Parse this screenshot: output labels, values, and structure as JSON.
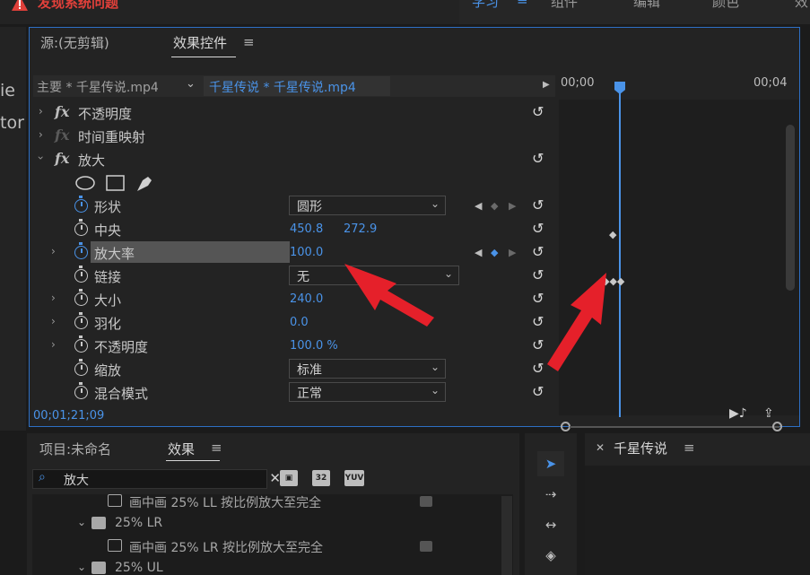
{
  "topbar": {
    "warning": "发现系统问题",
    "workspaces": [
      "学习",
      "组件",
      "编辑",
      "颜色",
      "效"
    ],
    "menu_glyph": "≡"
  },
  "leftcut": [
    "ie",
    "tor"
  ],
  "effect_controls": {
    "tabs": [
      "源:(无剪辑)",
      "效果控件"
    ],
    "menu_glyph": "≡",
    "master_clip": "主要 * 千星传说.mp4",
    "sequence_clip": "千星传说 * 千星传说.mp4",
    "timecode": "00;01;21;09",
    "effects": [
      {
        "name": "不透明度",
        "expanded": false
      },
      {
        "name": "时间重映射",
        "expanded": false
      },
      {
        "name": "放大",
        "expanded": true
      }
    ],
    "properties": [
      {
        "name": "形状",
        "type": "dropdown",
        "value": "圆形"
      },
      {
        "name": "中央",
        "type": "pair",
        "values": [
          "450.8",
          "272.9"
        ]
      },
      {
        "name": "放大率",
        "type": "value",
        "value": "100.0"
      },
      {
        "name": "链接",
        "type": "dropdown",
        "value": "无"
      },
      {
        "name": "大小",
        "type": "value",
        "value": "240.0"
      },
      {
        "name": "羽化",
        "type": "value",
        "value": "0.0"
      },
      {
        "name": "不透明度",
        "type": "value",
        "value": "100.0 %"
      },
      {
        "name": "缩放",
        "type": "dropdown",
        "value": "标准"
      },
      {
        "name": "混合模式",
        "type": "dropdown",
        "value": "正常"
      }
    ],
    "ruler": [
      "00;00",
      "00;04"
    ]
  },
  "project_panel": {
    "tabs": [
      "项目:未命名",
      "效果"
    ],
    "menu_glyph": "≡",
    "search_value": "放大",
    "toolbar_icons": [
      "32",
      "YUV"
    ],
    "items": [
      {
        "label": "画中画 25% LL 按比例放大至完全",
        "kind": "preset"
      },
      {
        "label": "25% LR",
        "kind": "folder"
      },
      {
        "label": "画中画 25% LR 按比例放大至完全",
        "kind": "preset"
      },
      {
        "label": "25% UL",
        "kind": "folder"
      }
    ]
  },
  "program": {
    "title": "千星传说",
    "menu_glyph": "≡"
  },
  "colors": {
    "accent": "#4a93e8",
    "arrow": "#e5202a"
  }
}
